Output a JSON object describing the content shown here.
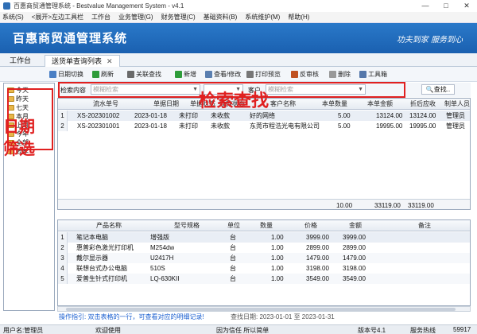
{
  "window": {
    "title": "百惠商贸通管理系统 - Bestvalue Management System - v4.1",
    "controls": [
      "—",
      "□",
      "✕"
    ]
  },
  "menu": [
    "系统(S)",
    "<展开>左边工具栏",
    "工作台",
    "业务管理(G)",
    "财务管理(C)",
    "基础资料(B)",
    "系统维护(M)",
    "帮助(H)"
  ],
  "banner": {
    "title": "百惠商贸通管理系统",
    "slogan": "功夫到家 服务到心"
  },
  "tabs": {
    "home": "工作台",
    "list": "送货单查询列表"
  },
  "toolbar": [
    {
      "label": "日期切换",
      "icon": "calendar-icon",
      "color": "#4a7fc4"
    },
    {
      "label": "刷新",
      "icon": "refresh-icon",
      "color": "#2e9c3a"
    },
    {
      "label": "关联查找",
      "icon": "link-icon",
      "color": "#6a6a6a"
    },
    {
      "label": "新增",
      "icon": "add-icon",
      "color": "#2e9c3a"
    },
    {
      "label": "查看/修改",
      "icon": "edit-icon",
      "color": "#5a7fb0"
    },
    {
      "label": "打印预览",
      "icon": "print-icon",
      "color": "#777777"
    },
    {
      "label": "反审核",
      "icon": "unaudit-icon",
      "color": "#c05020"
    },
    {
      "label": "删除",
      "icon": "delete-icon",
      "color": "#999999"
    },
    {
      "label": "工具箱",
      "icon": "toolbox-icon",
      "color": "#5577aa"
    }
  ],
  "date_filters": [
    "今天",
    "昨天",
    "七天",
    "本月",
    "上月",
    "今年",
    "全部",
    "去年"
  ],
  "search": {
    "label": "检索内容",
    "placeholder": "模糊检索",
    "customer_label": "客户",
    "customer_placeholder": "模糊检索",
    "button": "查找.."
  },
  "annotations": {
    "search": "检索查找",
    "date": "日期筛选"
  },
  "upper_table": {
    "headers": [
      "流水单号",
      "单据日期",
      "单据状态",
      "收款状态",
      "客户名称",
      "本单数量",
      "本单金额",
      "折后应收",
      "制单人员"
    ],
    "rows": [
      {
        "n": "1",
        "no": "XS-202301002",
        "date": "2023-01-18",
        "status": "未打印",
        "pay": "未收款",
        "customer": "好的网络",
        "qty": "5.00",
        "amount": "13124.00",
        "due": "13124.00",
        "maker": "管理员"
      },
      {
        "n": "2",
        "no": "XS-202301001",
        "date": "2023-01-18",
        "status": "未打印",
        "pay": "未收款",
        "customer": "东莞市程浩光电有限公司",
        "qty": "5.00",
        "amount": "19995.00",
        "due": "19995.00",
        "maker": "管理员"
      }
    ],
    "totals": {
      "qty": "10.00",
      "amount": "33119.00",
      "due": "33119.00"
    }
  },
  "lower_table": {
    "headers": [
      "产品名称",
      "型号规格",
      "单位",
      "数量",
      "价格",
      "金额",
      "备注"
    ],
    "rows": [
      {
        "n": "1",
        "name": "笔记本电脑",
        "model": "增强版",
        "unit": "台",
        "qty": "1.00",
        "price": "3999.00",
        "amount": "3999.00"
      },
      {
        "n": "2",
        "name": "惠普彩色激光打印机",
        "model": "M254dw",
        "unit": "台",
        "qty": "1.00",
        "price": "2899.00",
        "amount": "2899.00"
      },
      {
        "n": "3",
        "name": "戴尔显示器",
        "model": "U2417H",
        "unit": "台",
        "qty": "1.00",
        "price": "1479.00",
        "amount": "1479.00"
      },
      {
        "n": "4",
        "name": "联想台式办公电脑",
        "model": "510S",
        "unit": "台",
        "qty": "1.00",
        "price": "3198.00",
        "amount": "3198.00"
      },
      {
        "n": "5",
        "name": "爱普生针式打印机",
        "model": "LQ-630KII",
        "unit": "台",
        "qty": "1.00",
        "price": "3549.00",
        "amount": "3549.00"
      }
    ]
  },
  "hint": {
    "text": "操作指引: 双击表格的一行，可查看对应的明细记录!",
    "range": "查找日期: 2023-01-01 至 2023-01-31"
  },
  "status": {
    "user": "用户名:管理员",
    "welcome": "欢迎使用",
    "motto": "因为信任 所以简单",
    "version": "版本号4.1",
    "service": "服务热线",
    "number": "59917"
  }
}
